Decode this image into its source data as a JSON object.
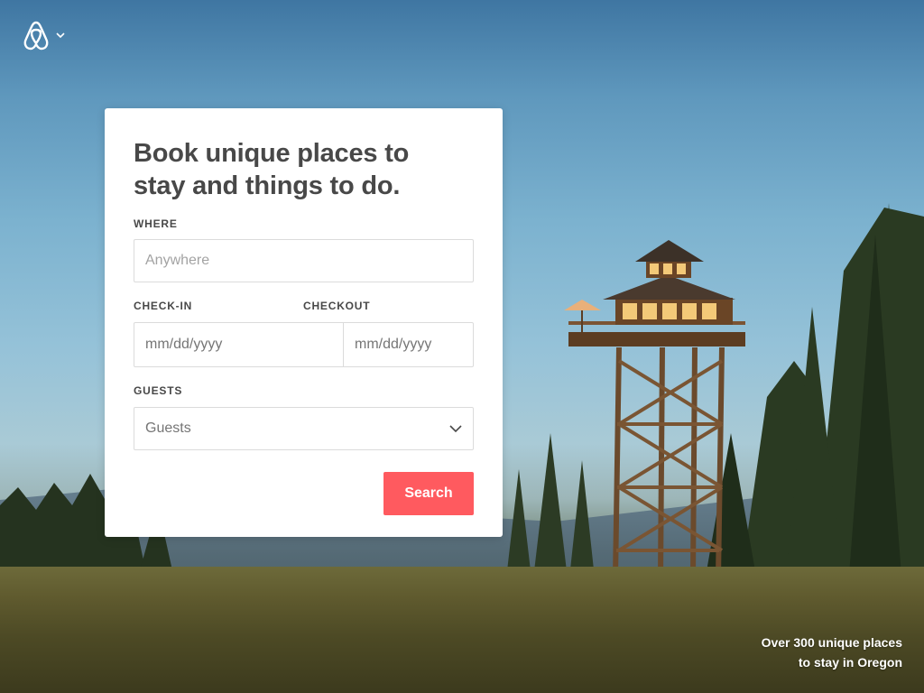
{
  "header": {
    "logo_icon": "airbnb-belo-icon",
    "menu_icon": "chevron-down-icon"
  },
  "search_card": {
    "title_line1": "Book unique places to",
    "title_line2": "stay and things to do.",
    "where_label": "WHERE",
    "where_placeholder": "Anywhere",
    "checkin_label": "CHECK-IN",
    "checkout_label": "CHECKOUT",
    "checkin_placeholder": "mm/dd/yyyy",
    "checkout_placeholder": "mm/dd/yyyy",
    "guests_label": "GUESTS",
    "guests_value": "Guests",
    "search_button": "Search"
  },
  "caption": {
    "line1": "Over 300 unique places",
    "line2": "to stay in Oregon"
  },
  "colors": {
    "brand": "#ff5a5f",
    "text": "#484848",
    "border": "#dbdbdb"
  }
}
